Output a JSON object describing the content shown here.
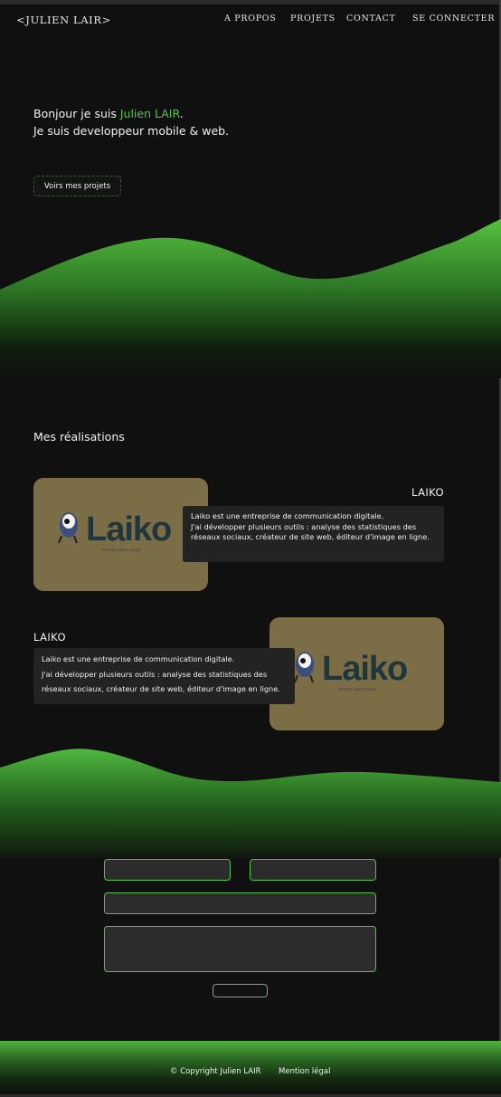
{
  "header": {
    "brand": "<JULIEN LAIR>",
    "nav": [
      "A PROPOS",
      "PROJETS",
      "CONTACT",
      "SE CONNECTER"
    ]
  },
  "hero": {
    "greeting_prefix": "Bonjour je suis ",
    "name": "Julien LAIR",
    "greeting_suffix": ".",
    "subtitle": "Je suis developpeur mobile & web.",
    "cta_label": "Voirs mes projets"
  },
  "projects": {
    "section_title": "Mes réalisations",
    "items": [
      {
        "title": "LAIKO",
        "logo_text": "Laiko",
        "logo_tagline": "Prenez votre envol",
        "line1": "Laiko est une entreprise de communication digitale.",
        "line2": "J'ai développer plusieurs outils : analyse des statistiques des réseaux sociaux, créateur de site web, éditeur d'image en ligne."
      },
      {
        "title": "LAIKO",
        "logo_text": "Laiko",
        "logo_tagline": "Prenez votre envol",
        "line1": "Laiko est une entreprise de communication digitale.",
        "line2": "J'ai développer plusieurs outils : analyse des statistiques des réseaux sociaux, créateur de site web, éditeur d'image en ligne."
      }
    ]
  },
  "footer": {
    "copyright": "© Copyright Julien LAIR",
    "legal": "Mention légal"
  },
  "colors": {
    "accent": "#56c34a",
    "background": "#101010",
    "card": "#7b6d45",
    "logo": "#20363d"
  }
}
